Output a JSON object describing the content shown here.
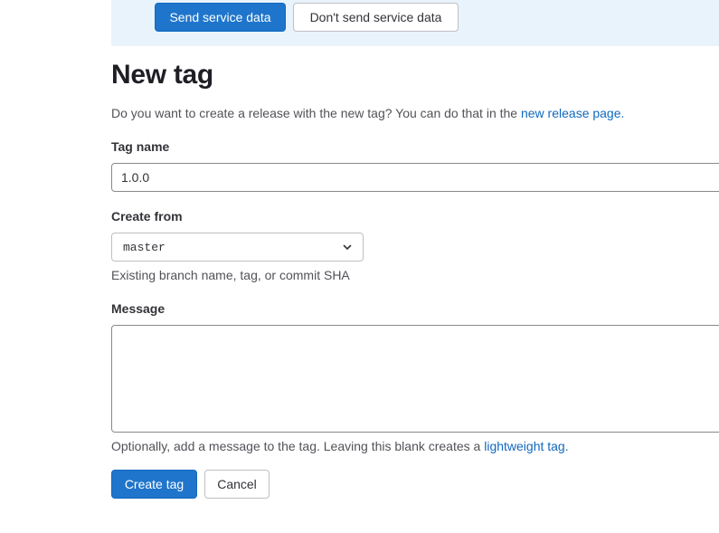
{
  "banner": {
    "send_label": "Send service data",
    "dont_send_label": "Don't send service data"
  },
  "page": {
    "title": "New tag",
    "intro_text": "Do you want to create a release with the new tag? You can do that in the ",
    "intro_link": "new release page."
  },
  "form": {
    "tag_name": {
      "label": "Tag name",
      "value": "1.0.0"
    },
    "create_from": {
      "label": "Create from",
      "selected": "master",
      "help": "Existing branch name, tag, or commit SHA"
    },
    "message": {
      "label": "Message",
      "value": "",
      "help_text": "Optionally, add a message to the tag. Leaving this blank creates a ",
      "help_link": "lightweight tag."
    }
  },
  "actions": {
    "create_label": "Create tag",
    "cancel_label": "Cancel"
  },
  "colors": {
    "primary": "#1f75cb",
    "link": "#1068bf",
    "banner_bg": "#e9f3fc"
  },
  "icons": {
    "select_chevron": "chevron-down-icon"
  }
}
